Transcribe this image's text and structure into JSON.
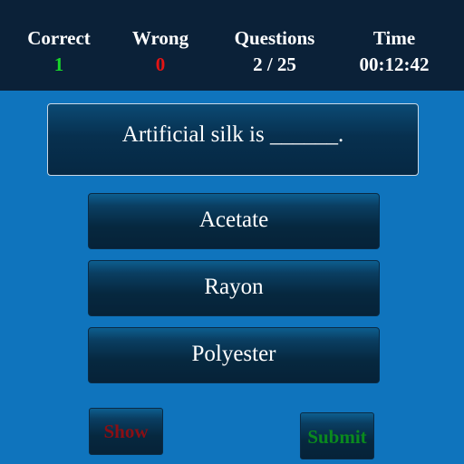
{
  "stats": {
    "correct": {
      "label": "Correct",
      "value": "1",
      "color": "#18d62a"
    },
    "wrong": {
      "label": "Wrong",
      "value": "0",
      "color": "#e31414"
    },
    "questions": {
      "label": "Questions",
      "value": "2 / 25"
    },
    "time": {
      "label": "Time",
      "value": "00:12:42"
    }
  },
  "question": {
    "text": "Artificial silk is ______."
  },
  "options": [
    {
      "label": "Acetate"
    },
    {
      "label": "Rayon"
    },
    {
      "label": "Polyester"
    }
  ],
  "actions": {
    "show_label": "Show",
    "show_color": "#8a0f14",
    "submit_label": "Submit",
    "submit_color": "#0a8a1e"
  },
  "colors": {
    "background": "#0f74bd",
    "stats_bar": "#0b2138"
  }
}
